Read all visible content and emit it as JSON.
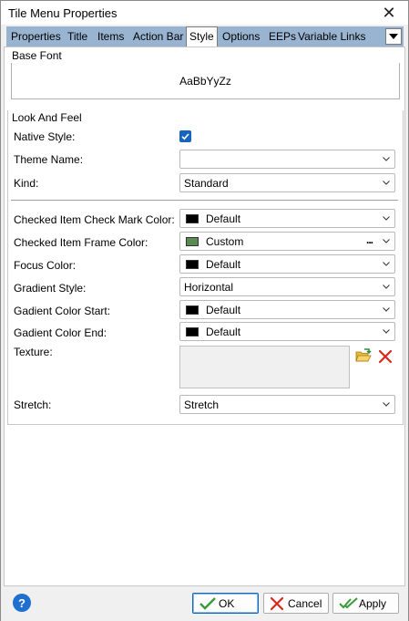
{
  "window": {
    "title": "Tile Menu Properties"
  },
  "tabs": [
    {
      "label": "Properties"
    },
    {
      "label": "Title"
    },
    {
      "label": "Items"
    },
    {
      "label": "Action Bar"
    },
    {
      "label": "Style"
    },
    {
      "label": "Options"
    },
    {
      "label": "EEPs"
    },
    {
      "label": "Variable Links"
    }
  ],
  "active_tab": "Style",
  "base_font": {
    "group_label": "Base Font",
    "sample": "AaBbYyZz"
  },
  "look_and_feel": {
    "group_label": "Look And Feel",
    "native_style": {
      "label": "Native Style:",
      "checked": true
    },
    "theme_name": {
      "label": "Theme Name:",
      "value": ""
    },
    "kind": {
      "label": "Kind:",
      "value": "Standard"
    },
    "check_mark_color": {
      "label": "Checked Item Check Mark Color:",
      "value": "Default",
      "swatch": "#000000"
    },
    "frame_color": {
      "label": "Checked Item Frame Color:",
      "value": "Custom",
      "swatch": "#5c8a55",
      "dots": "..."
    },
    "focus_color": {
      "label": "Focus Color:",
      "value": "Default",
      "swatch": "#000000"
    },
    "gradient_style": {
      "label": "Gradient Style:",
      "value": "Horizontal"
    },
    "gradient_start": {
      "label": "Gadient Color Start:",
      "value": "Default",
      "swatch": "#000000"
    },
    "gradient_end": {
      "label": "Gadient Color End:",
      "value": "Default",
      "swatch": "#000000"
    },
    "texture": {
      "label": "Texture:"
    },
    "stretch": {
      "label": "Stretch:",
      "value": "Stretch"
    }
  },
  "footer": {
    "help": "?",
    "ok": "OK",
    "cancel": "Cancel",
    "apply": "Apply"
  },
  "colors": {
    "tab_strip": "#99b4d1",
    "checkbox": "#1565c0",
    "help_icon": "#1e6fd0",
    "ok_check": "#3c9a3c",
    "cancel_x": "#d9251c"
  }
}
